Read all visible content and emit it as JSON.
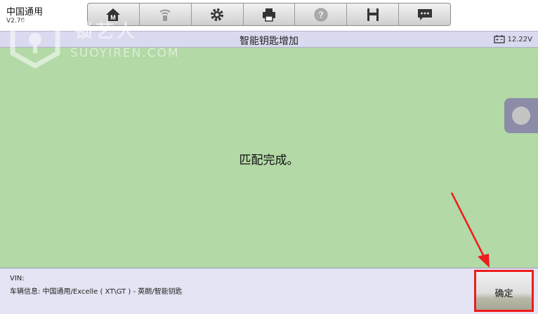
{
  "app": {
    "title": "中国通用",
    "version": "V2.70"
  },
  "toolbar": {
    "buttons": [
      {
        "icon": "home-icon"
      },
      {
        "icon": "vci-icon"
      },
      {
        "icon": "settings-gear-icon"
      },
      {
        "icon": "printer-icon"
      },
      {
        "icon": "help-icon"
      },
      {
        "icon": "save-icon"
      },
      {
        "icon": "message-icon"
      }
    ]
  },
  "titlebar": {
    "title": "智能钥匙增加",
    "battery_voltage": "12.22V"
  },
  "main": {
    "message": "匹配完成。"
  },
  "footer": {
    "vin_label": "VIN:",
    "vehicle_info": "车辆信息: 中国通用/Excelle ( XT\\GT ) - 英朗/智能钥匙"
  },
  "ok_button": {
    "label": "确定"
  },
  "watermark": {
    "text_cn": "锁艺人",
    "text_en": "SUOYIREN.COM"
  },
  "colors": {
    "main_bg": "#b3d9a6",
    "titlebar_bg": "#d9d9ef",
    "highlight": "#ee1c1c"
  }
}
